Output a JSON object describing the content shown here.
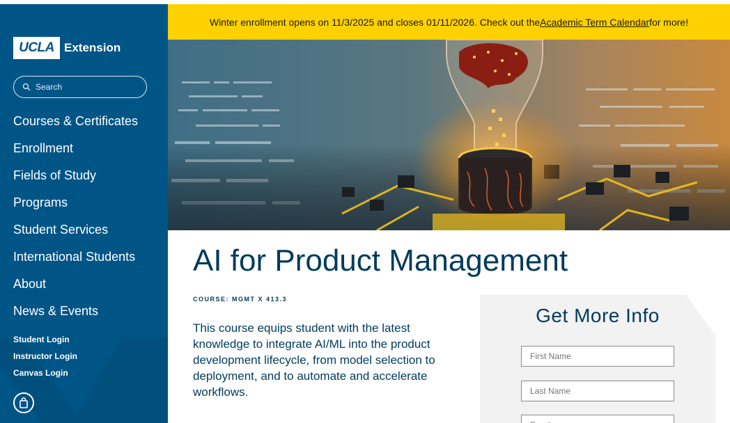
{
  "sidebar": {
    "logo": {
      "ucla": "UCLA",
      "extension": "Extension"
    },
    "search": {
      "placeholder": "Search"
    },
    "nav": [
      "Courses & Certificates",
      "Enrollment",
      "Fields of Study",
      "Programs",
      "Student Services",
      "International Students",
      "About",
      "News & Events"
    ],
    "logins": [
      "Student Login",
      "Instructor Login",
      "Canvas Login"
    ],
    "cart_icon": "shopping-bag-icon"
  },
  "banner": {
    "text_before": "Winter enrollment opens on 11/3/2025 and closes 01/11/2026. Check out the ",
    "link": "Academic Term Calendar",
    "text_after": " for more!"
  },
  "main": {
    "title": "AI for Product Management",
    "course_code": "COURSE: MGMT X 413.3",
    "description": "This course equips student with the latest knowledge to integrate AI/ML into the product development lifecycle, from model selection to deployment, and to automate and accelerate workflows."
  },
  "form": {
    "title": "Get More Info",
    "first_name_placeholder": "First Name",
    "last_name_placeholder": "Last Name",
    "email_placeholder": "Email"
  },
  "colors": {
    "sidebar": "#005587",
    "banner": "#ffd100",
    "heading": "#003b5c",
    "form_panel": "#f2f2f2"
  }
}
